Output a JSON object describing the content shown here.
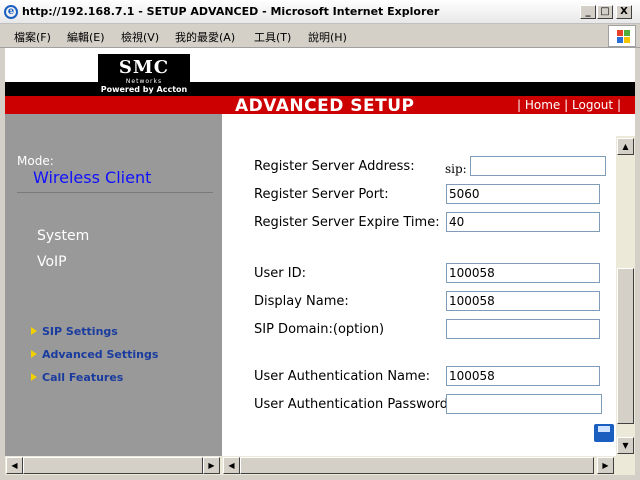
{
  "window": {
    "title": "http://192.168.7.1 - SETUP ADVANCED - Microsoft Internet Explorer",
    "icon": "ie-icon",
    "controls": [
      "_",
      "□",
      "X"
    ]
  },
  "menu": {
    "items": [
      "檔案(F)",
      "編輯(E)",
      "檢視(V)",
      "我的最愛(A)",
      "工具(T)",
      "說明(H)"
    ]
  },
  "header": {
    "logo_text": "SMC",
    "logo_subtext": "Networks",
    "logo_tagline": "Powered by Accton",
    "page_heading": "ADVANCED SETUP",
    "home_link": "Home",
    "logout_link": "Logout",
    "separator": "|",
    "colors": {
      "bar": "#cc0000",
      "top": "#000000"
    }
  },
  "sidebar": {
    "mode_label": "Mode:",
    "mode_value": "Wireless Client",
    "nav_system": "System",
    "nav_voip": "VoIP",
    "sub_items": [
      "SIP Settings",
      "Advanced Settings",
      "Call Features"
    ],
    "colors": {
      "background": "#999999",
      "mode_value": "#1010ff",
      "sub_item": "#1a3c9e"
    }
  },
  "form": {
    "sip_prefix": "sip:",
    "fields": [
      {
        "label": "Register Server Address:",
        "value": ""
      },
      {
        "label": "Register Server Port:",
        "value": "5060"
      },
      {
        "label": "Register Server Expire Time:",
        "value": "40"
      },
      {
        "label": "User ID:",
        "value": "100058"
      },
      {
        "label": "Display Name:",
        "value": "100058"
      },
      {
        "label": "SIP Domain:(option)",
        "value": ""
      },
      {
        "label": "User Authentication Name:",
        "value": "100058"
      },
      {
        "label": "User Authentication Password:",
        "value": ""
      }
    ]
  },
  "scrollbar": {
    "up": "▲",
    "down": "▼",
    "left": "◀",
    "right": "▶"
  }
}
